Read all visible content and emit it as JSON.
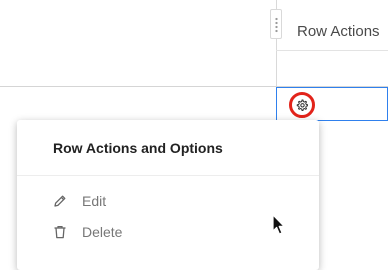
{
  "grid": {
    "column_header": "Row Actions",
    "selected_cell_border": "#2f80ed"
  },
  "row_actions": {
    "button_icon": "gear-icon",
    "highlight_color": "#e2231a"
  },
  "menu": {
    "title": "Row Actions and Options",
    "items": [
      {
        "label": "Edit",
        "icon": "pencil-icon"
      },
      {
        "label": "Delete",
        "icon": "trash-icon"
      }
    ]
  },
  "cursor": {
    "icon": "mouse-pointer-icon"
  }
}
